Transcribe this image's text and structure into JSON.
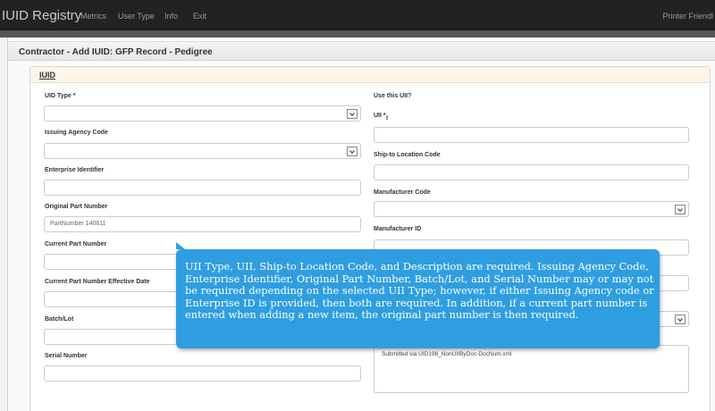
{
  "navbar": {
    "brand": "IUID Registry",
    "links": [
      "Metrics",
      "User Type",
      "Info",
      "Exit"
    ],
    "right_link": "Printer Friendl"
  },
  "page": {
    "title": "Contractor - Add IUID: GFP Record - Pedigree"
  },
  "panel": {
    "title": "IUID"
  },
  "left_fields": {
    "uid_type": {
      "label": "UID Type *",
      "value": ""
    },
    "issuing_agency_code": {
      "label": "Issuing Agency Code",
      "value": ""
    },
    "enterprise_identifier": {
      "label": "Enterprise Identifier",
      "value": ""
    },
    "original_part_number": {
      "label": "Original Part Number",
      "value": "PartNumber 140611"
    },
    "current_part_number": {
      "label": "Current Part Number",
      "value": ""
    },
    "current_part_number_effective_date": {
      "label": "Current Part Number Effective Date",
      "value": ""
    },
    "batch_lot": {
      "label": "Batch/Lot",
      "value": ""
    },
    "serial_number": {
      "label": "Serial Number",
      "value": ""
    }
  },
  "right_fields": {
    "use_this_uii": {
      "label": "Use this UII?"
    },
    "uii": {
      "label": "UII *",
      "label_sub": "2",
      "value": ""
    },
    "ship_to_location_code": {
      "label": "Ship-to Location Code",
      "value": ""
    },
    "manufacturer_code": {
      "label": "Manufacturer Code",
      "value": ""
    },
    "manufacturer_id": {
      "label": "Manufacturer ID",
      "value": ""
    },
    "description": {
      "value": "Submitted via UID198_NonUIIByDoc-DocNum.xml"
    }
  },
  "tooltip": {
    "text": "UII Type, UII, Ship-to Location Code, and Description are required. Issuing Agency Code, Enterprise Identifier, Original Part Number, Batch/Lot, and Serial Number may or may not be required depending on the selected UII Type; however, if either Issuing Agency code or Enterprise ID is provided, then both are required. In addition, if a current part number is entered when adding a new item, the original part number is then required."
  },
  "colors": {
    "navbar_bg": "#222222",
    "panel_heading_bg": "#fcf5e8",
    "tooltip_bg": "#2f9ee0"
  }
}
